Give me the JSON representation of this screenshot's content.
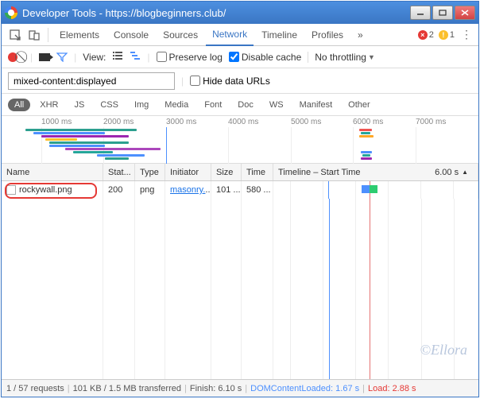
{
  "window": {
    "title": "Developer Tools - https://blogbeginners.club/"
  },
  "tabs": {
    "items": [
      "Elements",
      "Console",
      "Sources",
      "Network",
      "Timeline",
      "Profiles"
    ],
    "active": "Network",
    "overflow": "»",
    "errors": "2",
    "warnings": "1"
  },
  "toolbar": {
    "view_label": "View:",
    "preserve_log": "Preserve log",
    "preserve_checked": false,
    "disable_cache": "Disable cache",
    "disable_checked": true,
    "throttling": "No throttling"
  },
  "filter": {
    "value": "mixed-content:displayed ",
    "hide_data_urls": "Hide data URLs",
    "hide_checked": false
  },
  "type_filters": [
    "All",
    "XHR",
    "JS",
    "CSS",
    "Img",
    "Media",
    "Font",
    "Doc",
    "WS",
    "Manifest",
    "Other"
  ],
  "type_active": "All",
  "overview": {
    "ticks": [
      "1000 ms",
      "2000 ms",
      "3000 ms",
      "4000 ms",
      "5000 ms",
      "6000 ms",
      "7000 ms"
    ]
  },
  "columns": {
    "name": "Name",
    "status": "Stat...",
    "type": "Type",
    "initiator": "Initiator",
    "size": "Size",
    "time": "Time",
    "timeline": "Timeline – Start Time",
    "duration": "6.00 s"
  },
  "rows": [
    {
      "name": "rockywall.png",
      "status": "200",
      "type": "png",
      "initiator": "masonry.",
      "size": "101 ...",
      "time": "580 ..."
    }
  ],
  "statusbar": {
    "requests": "1 / 57 requests",
    "transferred": "101 KB / 1.5 MB transferred",
    "finish": "Finish: 6.10 s",
    "dcl": "DOMContentLoaded: 1.67 s",
    "load": "Load: 2.88 s"
  },
  "watermark": "©Ellora"
}
